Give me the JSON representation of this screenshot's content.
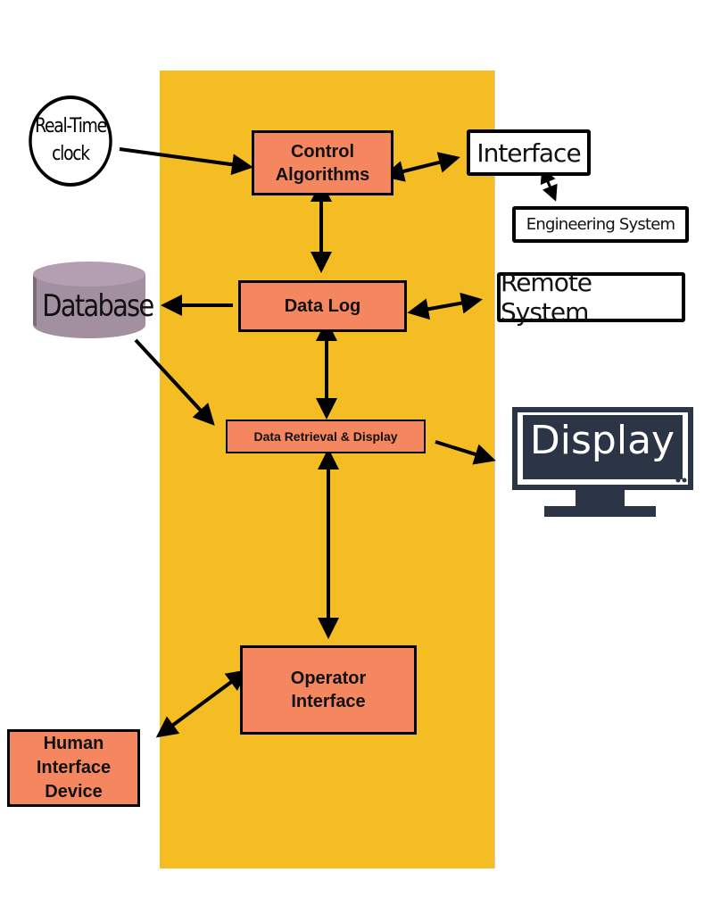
{
  "colors": {
    "panel": "#f3bd23",
    "process_box": "#f58760",
    "database": "#a28fa0",
    "monitor": "#2b3546",
    "arrow": "#000000"
  },
  "nodes": {
    "clock": {
      "label": "Real-Time\nclock",
      "icon": "clock-circle"
    },
    "control_algorithms": {
      "label": "Control\nAlgorithms"
    },
    "interface": {
      "label": "Interface"
    },
    "engineering_system": {
      "label": "Engineering System"
    },
    "data_log": {
      "label": "Data Log"
    },
    "remote_system": {
      "label": "Remote System"
    },
    "database": {
      "label": "Database",
      "icon": "database-cylinder-icon"
    },
    "data_retrieval": {
      "label": "Data Retrieval & Display"
    },
    "display": {
      "label": "Display",
      "icon": "monitor-icon"
    },
    "operator_interface": {
      "label": "Operator\nInterface"
    },
    "human_interface_device": {
      "label": "Human\nInterface\nDevice"
    }
  },
  "edges": [
    {
      "from": "clock",
      "to": "control_algorithms",
      "direction": "one-way"
    },
    {
      "from": "control_algorithms",
      "to": "interface",
      "direction": "two-way"
    },
    {
      "from": "interface",
      "to": "engineering_system",
      "direction": "two-way"
    },
    {
      "from": "control_algorithms",
      "to": "data_log",
      "direction": "two-way"
    },
    {
      "from": "data_log",
      "to": "database",
      "direction": "one-way"
    },
    {
      "from": "data_log",
      "to": "remote_system",
      "direction": "two-way"
    },
    {
      "from": "data_log",
      "to": "data_retrieval",
      "direction": "two-way"
    },
    {
      "from": "database",
      "to": "data_retrieval",
      "direction": "one-way"
    },
    {
      "from": "data_retrieval",
      "to": "display",
      "direction": "one-way"
    },
    {
      "from": "data_retrieval",
      "to": "operator_interface",
      "direction": "two-way"
    },
    {
      "from": "operator_interface",
      "to": "human_interface_device",
      "direction": "two-way"
    }
  ]
}
